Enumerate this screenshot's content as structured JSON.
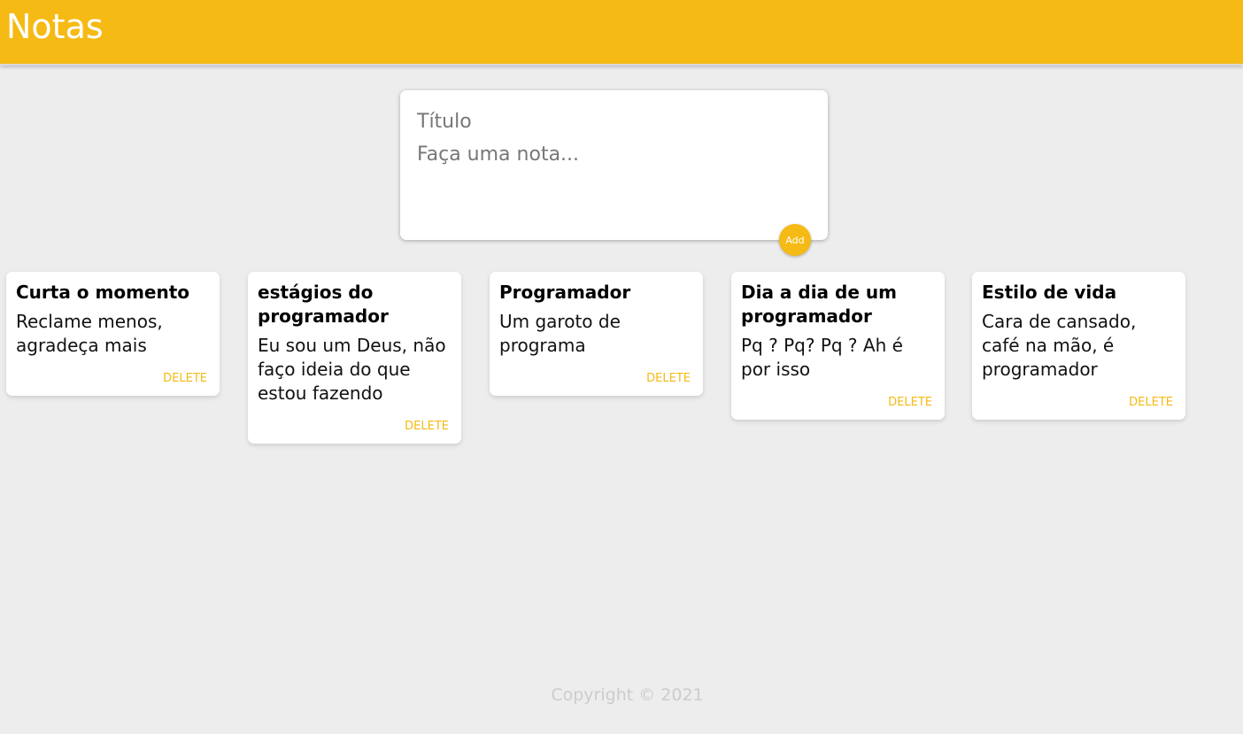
{
  "header": {
    "title": "Notas"
  },
  "create_area": {
    "title_placeholder": "Título",
    "content_placeholder": "Faça uma nota...",
    "add_label": "Add"
  },
  "notes": [
    {
      "title": "Curta o momento",
      "content": "Reclame menos, agradeça mais",
      "delete_label": "DELETE"
    },
    {
      "title": "estágios do programador",
      "content": "Eu sou um Deus, não faço ideia do que estou fazendo",
      "delete_label": "DELETE"
    },
    {
      "title": "Programador",
      "content": "Um garoto de programa",
      "delete_label": "DELETE"
    },
    {
      "title": "Dia a dia de um programador",
      "content": "Pq ? Pq? Pq ? Ah é por isso",
      "delete_label": "DELETE"
    },
    {
      "title": "Estilo de vida",
      "content": "Cara de cansado, café na mão, é programador",
      "delete_label": "DELETE"
    }
  ],
  "footer": {
    "copyright": "Copyright © 2021"
  },
  "colors": {
    "accent": "#f5ba13",
    "background": "#ededed",
    "card": "#ffffff"
  }
}
